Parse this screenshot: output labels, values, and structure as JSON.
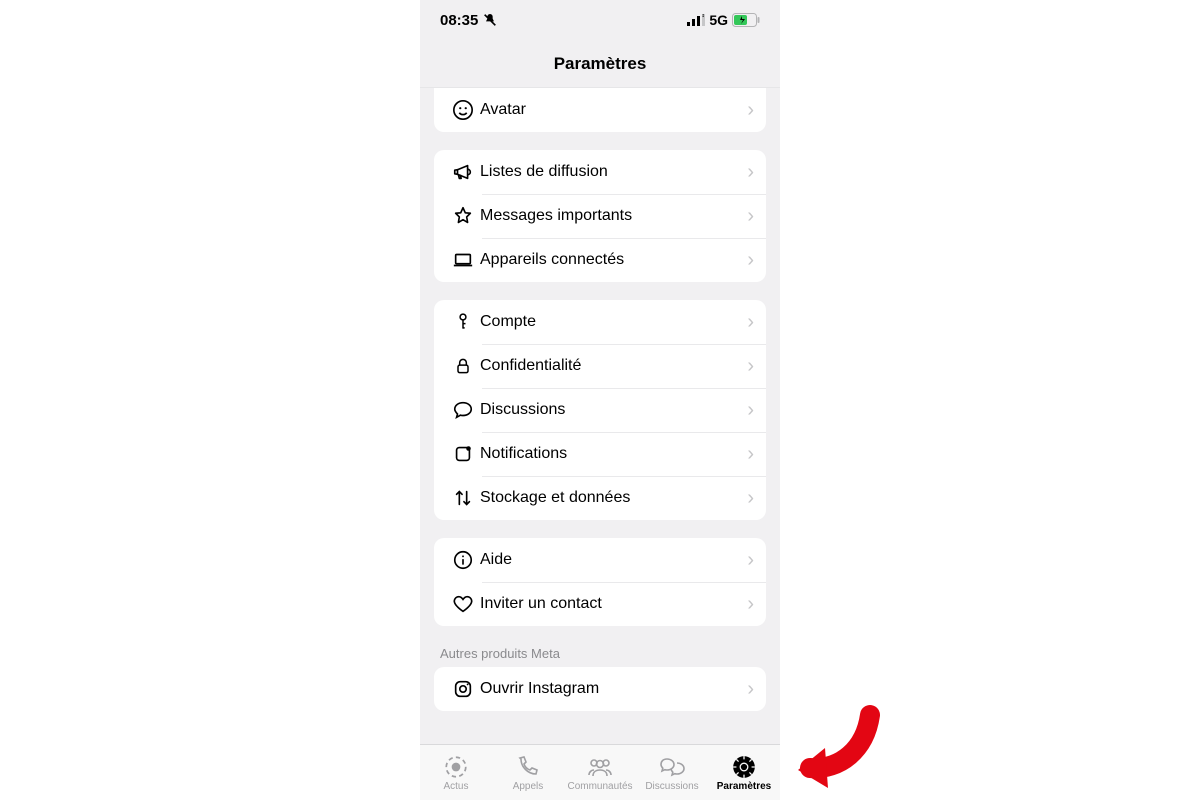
{
  "status": {
    "time": "08:35",
    "network": "5G"
  },
  "header": {
    "title": "Paramètres"
  },
  "group0": {
    "avatar": "Avatar"
  },
  "group1": {
    "broadcast": "Listes de diffusion",
    "starred": "Messages importants",
    "linked": "Appareils connectés"
  },
  "group2": {
    "account": "Compte",
    "privacy": "Confidentialité",
    "chats": "Discussions",
    "notifications": "Notifications",
    "storage": "Stockage et données"
  },
  "group3": {
    "help": "Aide",
    "invite": "Inviter un contact"
  },
  "meta_section": "Autres produits Meta",
  "group4": {
    "instagram": "Ouvrir Instagram"
  },
  "tabs": {
    "updates": "Actus",
    "calls": "Appels",
    "communities": "Communautés",
    "chats": "Discussions",
    "settings": "Paramètres"
  }
}
